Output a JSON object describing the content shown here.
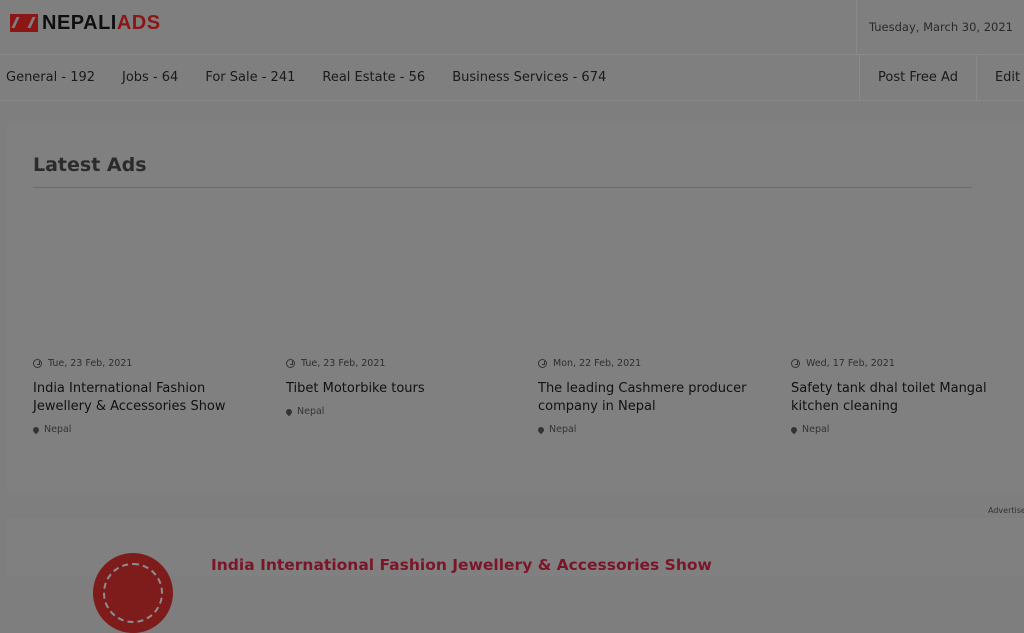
{
  "header": {
    "logo": {
      "part1": "NEPALI",
      "part2": "ADS"
    },
    "date": "Tuesday, March 30, 2021"
  },
  "nav": {
    "categories": [
      {
        "label": "General - 192"
      },
      {
        "label": "Jobs - 64"
      },
      {
        "label": "For Sale - 241"
      },
      {
        "label": "Real Estate - 56"
      },
      {
        "label": "Business Services - 674"
      }
    ],
    "actions": [
      {
        "label": "Post Free Ad"
      },
      {
        "label": "Edit A"
      }
    ]
  },
  "latest": {
    "title": "Latest Ads",
    "ads": [
      {
        "date": "Tue, 23 Feb, 2021",
        "title": "India International Fashion Jewellery & Accessories Show",
        "location": "Nepal"
      },
      {
        "date": "Tue, 23 Feb, 2021",
        "title": "Tibet Motorbike tours",
        "location": "Nepal"
      },
      {
        "date": "Mon, 22 Feb, 2021",
        "title": "The leading Cashmere producer company in Nepal",
        "location": "Nepal"
      },
      {
        "date": "Wed, 17 Feb, 2021",
        "title": "Safety tank dhal toilet Mangal kitchen cleaning",
        "location": "Nepal"
      }
    ]
  },
  "advertisement": {
    "label": "Advertise"
  },
  "featured": {
    "title": "India International Fashion Jewellery & Accessories Show"
  },
  "colors": {
    "brand_red": "#8a1616",
    "featured_title": "#7a1628",
    "overlay_gray": "#7e7e7e"
  }
}
